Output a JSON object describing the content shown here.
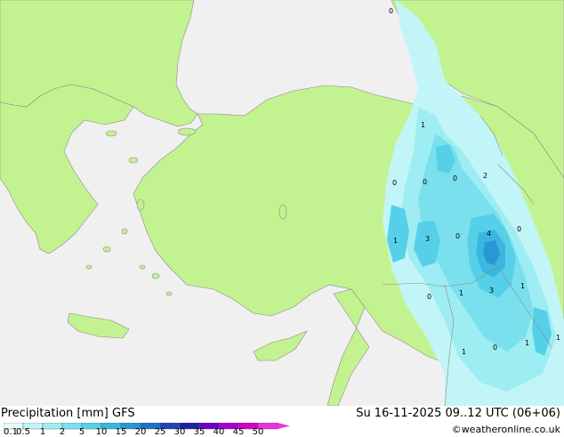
{
  "footer": {
    "title": "Precipitation [mm] GFS",
    "datetime": "Su 16-11-2025 09..12 UTC (06+06)",
    "credit": "©weatheronline.co.uk"
  },
  "legend": {
    "ticks": [
      "0.1",
      "0.5",
      "1",
      "2",
      "5",
      "10",
      "15",
      "20",
      "25",
      "30",
      "35",
      "40",
      "45",
      "50"
    ],
    "colors": [
      "#e6fcfc",
      "#c2f5f7",
      "#9eedf2",
      "#7ae0ee",
      "#56d0e8",
      "#39b7e0",
      "#2997d4",
      "#1f6fc4",
      "#1d48b4",
      "#1c22a0",
      "#6a00c8",
      "#a600d0",
      "#d200c8",
      "#ec32dc"
    ]
  },
  "colors": {
    "sea": "#f0f0f0",
    "land": "#c3f391",
    "coast": "#8a8a8a"
  },
  "map": {
    "values": [
      {
        "label": "0"
      },
      {
        "label": "1"
      },
      {
        "label": "0"
      },
      {
        "label": "0"
      },
      {
        "label": "0"
      },
      {
        "label": "2"
      },
      {
        "label": "1"
      },
      {
        "label": "3"
      },
      {
        "label": "0"
      },
      {
        "label": "4"
      },
      {
        "label": "0"
      },
      {
        "label": "0"
      },
      {
        "label": "1"
      },
      {
        "label": "3"
      },
      {
        "label": "1"
      },
      {
        "label": "1"
      },
      {
        "label": "0"
      },
      {
        "label": "1"
      },
      {
        "label": "1"
      }
    ]
  }
}
